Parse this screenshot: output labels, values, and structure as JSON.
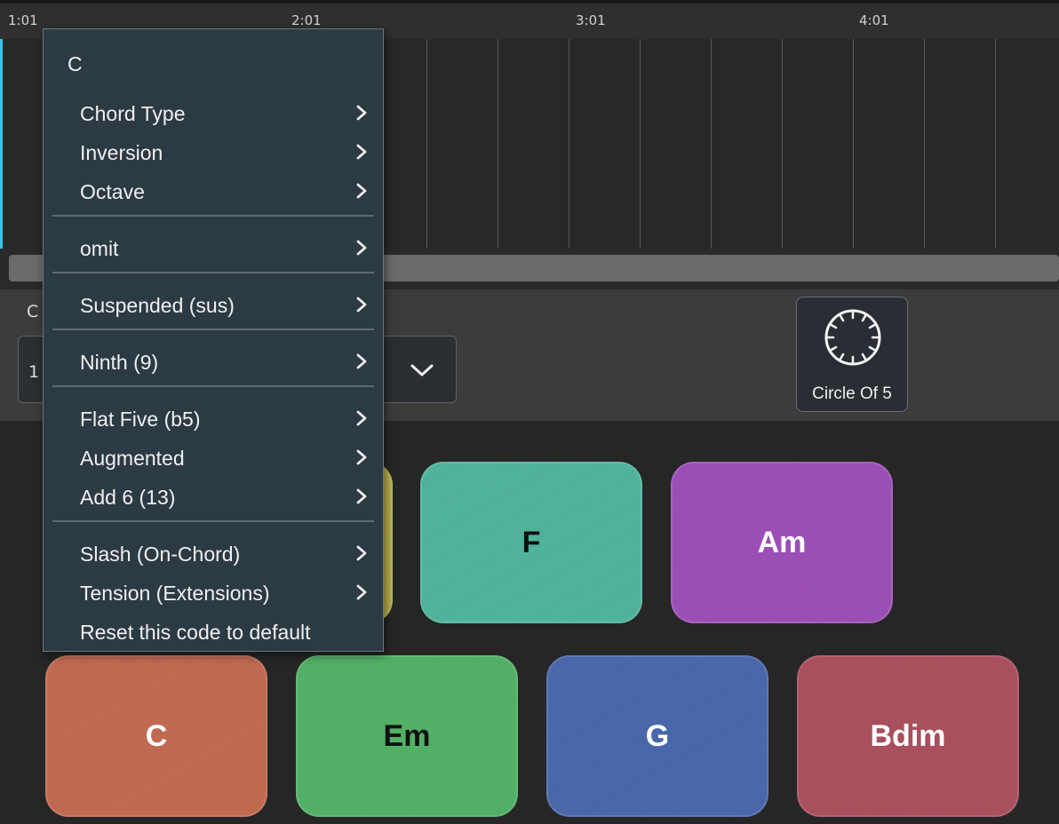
{
  "timeline": {
    "markers": [
      "1:01",
      "2:01",
      "3:01",
      "4:01"
    ]
  },
  "panel": {
    "label": "C",
    "dropdown_value": "1",
    "circle_of_5_label": "Circle Of 5"
  },
  "context_menu": {
    "title": "C",
    "items": {
      "chord_type": "Chord Type",
      "inversion": "Inversion",
      "octave": "Octave",
      "omit": "omit",
      "suspended": "Suspended (sus)",
      "ninth": "Ninth (9)",
      "flat_five": "Flat Five (b5)",
      "augmented": "Augmented",
      "add6": "Add 6 (13)",
      "slash": "Slash (On-Chord)",
      "tension": "Tension (Extensions)",
      "reset": "Reset this code to default"
    }
  },
  "pads": {
    "f": {
      "label": "F",
      "color": "#4fb39a"
    },
    "am": {
      "label": "Am",
      "color": "#9b4fb5"
    },
    "c": {
      "label": "C",
      "color": "#c06a52"
    },
    "em": {
      "label": "Em",
      "color": "#52b066"
    },
    "g": {
      "label": "G",
      "color": "#4a67ab"
    },
    "bdim": {
      "label": "Bdim",
      "color": "#a8505e"
    },
    "hidden_yellow": {
      "color": "#b8b04a"
    }
  },
  "colors": {
    "playhead": "#2ec7e6",
    "menu_bg": "#2c3a44"
  }
}
